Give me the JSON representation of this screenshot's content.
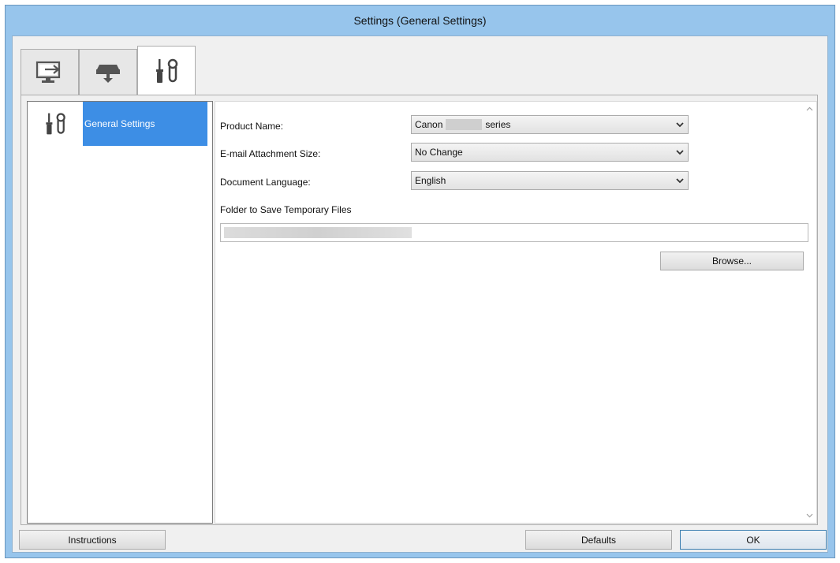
{
  "window": {
    "title": "Settings (General Settings)"
  },
  "tabs": [
    {
      "icon": "computer-scan-icon",
      "active": false
    },
    {
      "icon": "scanner-icon",
      "active": false
    },
    {
      "icon": "tools-icon",
      "active": true
    }
  ],
  "sidebar": {
    "items": [
      {
        "icon": "tools-icon",
        "label": "General Settings",
        "selected": true
      }
    ]
  },
  "settings": {
    "product_name": {
      "label": "Product Name:",
      "value_prefix": "Canon",
      "value_suffix": "series"
    },
    "email_attachment_size": {
      "label": "E-mail Attachment Size:",
      "value": "No Change"
    },
    "document_language": {
      "label": "Document Language:",
      "value": "English"
    },
    "temp_folder": {
      "label": "Folder to Save Temporary Files",
      "browse_label": "Browse..."
    }
  },
  "footer": {
    "instructions_label": "Instructions",
    "defaults_label": "Defaults",
    "ok_label": "OK"
  },
  "colors": {
    "title_frame": "#97c5ec",
    "selection": "#3d8ee5"
  }
}
